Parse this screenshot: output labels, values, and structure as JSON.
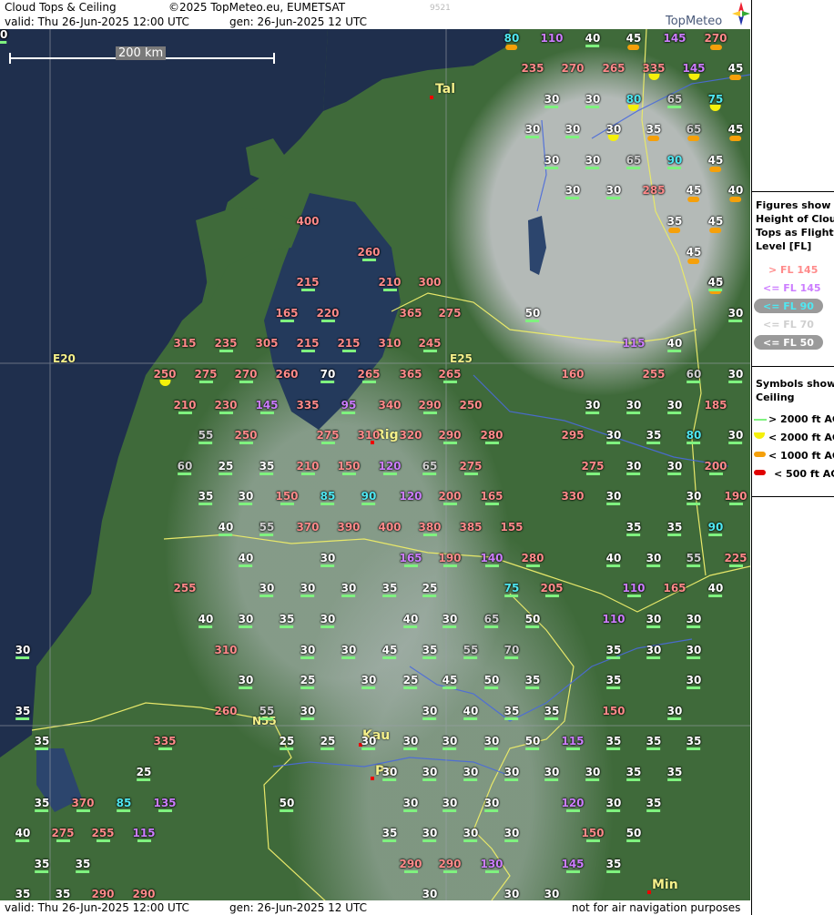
{
  "header": {
    "title": "Cloud Tops & Ceiling",
    "copyright": "©2025 TopMeteo.eu, EUMETSAT",
    "code": "9521",
    "valid": "valid:  Thu  26-Jun-2025  12:00 UTC",
    "gen": "gen: 26-Jun-2025 12 UTC",
    "logo": "TopMeteo"
  },
  "footer": {
    "valid": "valid:  Thu  26-Jun-2025  12:00 UTC",
    "gen": "gen: 26-Jun-2025 12 UTC",
    "disclaimer": "not for air navigation purposes"
  },
  "scale_label": "200 km",
  "grid_labels": [
    "E20",
    "E25",
    "N55"
  ],
  "cities": [
    "Tal",
    "Rig",
    "Kau",
    "Pa",
    "Min"
  ],
  "legend": {
    "fig_heading": [
      "Figures show",
      "Height of Cloud",
      "Tops as Flight",
      "Level  [FL]"
    ],
    "fig_items": [
      "> FL 145",
      "<= FL 145",
      "<= FL 90",
      "<= FL 70",
      "<= FL 50"
    ],
    "sym_heading": [
      "Symbols show",
      "Ceiling"
    ],
    "sym_items": [
      "> 2000 ft AGL",
      "< 2000 ft AGL",
      "< 1000 ft AGL",
      "< 500 ft AGL"
    ],
    "colors": {
      "pink": "#ff8a8a",
      "violet": "#cc7dff",
      "cyan": "#4fe8f2",
      "grey": "#cfcfcf",
      "white": "#ffffff",
      "green": "#7ff27f",
      "yellow": "#f5f00a",
      "orange": "#f5a00a",
      "red": "#e00000"
    }
  },
  "cloud_tops": [
    {
      "v": "80",
      "c": "cyan",
      "s": "o"
    },
    {
      "v": "110",
      "c": "violet",
      "s": ""
    },
    {
      "v": "40",
      "c": "white",
      "s": "g"
    },
    {
      "v": "45",
      "c": "white",
      "s": "o"
    },
    {
      "v": "145",
      "c": "violet",
      "s": ""
    },
    {
      "v": "270",
      "c": "pink",
      "s": "o"
    },
    {
      "v": "235",
      "c": "pink",
      "s": ""
    },
    {
      "v": "270",
      "c": "pink",
      "s": ""
    },
    {
      "v": "265",
      "c": "pink",
      "s": ""
    },
    {
      "v": "335",
      "c": "pink",
      "s": "y"
    },
    {
      "v": "145",
      "c": "violet",
      "s": "y"
    },
    {
      "v": "45",
      "c": "white",
      "s": "o"
    },
    {
      "v": "30",
      "c": "white",
      "s": "g"
    },
    {
      "v": "30",
      "c": "white",
      "s": "g"
    },
    {
      "v": "80",
      "c": "cyan",
      "s": "y"
    },
    {
      "v": "65",
      "c": "grey",
      "s": "g"
    },
    {
      "v": "75",
      "c": "cyan",
      "s": "y"
    },
    {
      "v": "30",
      "c": "white",
      "s": "g"
    },
    {
      "v": "30",
      "c": "white",
      "s": "g"
    },
    {
      "v": "30",
      "c": "white",
      "s": "y"
    },
    {
      "v": "35",
      "c": "white",
      "s": "o"
    },
    {
      "v": "65",
      "c": "grey",
      "s": "o"
    },
    {
      "v": "45",
      "c": "white",
      "s": "o"
    },
    {
      "v": "30",
      "c": "white",
      "s": "g"
    },
    {
      "v": "30",
      "c": "white",
      "s": "g"
    },
    {
      "v": "65",
      "c": "grey",
      "s": "g"
    },
    {
      "v": "90",
      "c": "cyan",
      "s": "g"
    },
    {
      "v": "45",
      "c": "white",
      "s": "o"
    },
    {
      "v": "30",
      "c": "white",
      "s": "g"
    },
    {
      "v": "30",
      "c": "white",
      "s": "g"
    },
    {
      "v": "285",
      "c": "pink",
      "s": ""
    },
    {
      "v": "45",
      "c": "white",
      "s": "o"
    },
    {
      "v": "40",
      "c": "white",
      "s": "o"
    },
    {
      "v": "35",
      "c": "white",
      "s": "o"
    },
    {
      "v": "45",
      "c": "white",
      "s": "o"
    },
    {
      "v": "45",
      "c": "white",
      "s": "o"
    },
    {
      "v": "40",
      "c": "white",
      "s": "o"
    },
    {
      "v": "45",
      "c": "white",
      "s": "g"
    },
    {
      "v": "400",
      "c": "pink",
      "s": ""
    },
    {
      "v": "260",
      "c": "pink",
      "s": "g"
    },
    {
      "v": "215",
      "c": "pink",
      "s": "g"
    },
    {
      "v": "210",
      "c": "pink",
      "s": "g"
    },
    {
      "v": "300",
      "c": "pink",
      "s": ""
    },
    {
      "v": "165",
      "c": "pink",
      "s": "g"
    },
    {
      "v": "220",
      "c": "pink",
      "s": "g"
    },
    {
      "v": "365",
      "c": "pink",
      "s": ""
    },
    {
      "v": "275",
      "c": "pink",
      "s": ""
    },
    {
      "v": "50",
      "c": "white",
      "s": "g"
    },
    {
      "v": "30",
      "c": "white",
      "s": "g"
    },
    {
      "v": "315",
      "c": "pink",
      "s": ""
    },
    {
      "v": "235",
      "c": "pink",
      "s": "g"
    },
    {
      "v": "305",
      "c": "pink",
      "s": ""
    },
    {
      "v": "215",
      "c": "pink",
      "s": "g"
    },
    {
      "v": "215",
      "c": "pink",
      "s": "g"
    },
    {
      "v": "310",
      "c": "pink",
      "s": ""
    },
    {
      "v": "245",
      "c": "pink",
      "s": "g"
    },
    {
      "v": "115",
      "c": "violet",
      "s": ""
    },
    {
      "v": "40",
      "c": "white",
      "s": "g"
    },
    {
      "v": "250",
      "c": "pink",
      "s": "y"
    },
    {
      "v": "275",
      "c": "pink",
      "s": "g"
    },
    {
      "v": "270",
      "c": "pink",
      "s": "g"
    },
    {
      "v": "260",
      "c": "pink",
      "s": ""
    },
    {
      "v": "70",
      "c": "white",
      "s": "g"
    },
    {
      "v": "265",
      "c": "pink",
      "s": "g"
    },
    {
      "v": "365",
      "c": "pink",
      "s": ""
    },
    {
      "v": "265",
      "c": "pink",
      "s": "g"
    },
    {
      "v": "160",
      "c": "pink",
      "s": ""
    },
    {
      "v": "255",
      "c": "pink",
      "s": ""
    },
    {
      "v": "60",
      "c": "grey",
      "s": "g"
    },
    {
      "v": "30",
      "c": "white",
      "s": "g"
    },
    {
      "v": "210",
      "c": "pink",
      "s": "g"
    },
    {
      "v": "230",
      "c": "pink",
      "s": "g"
    },
    {
      "v": "145",
      "c": "violet",
      "s": "g"
    },
    {
      "v": "335",
      "c": "pink",
      "s": ""
    },
    {
      "v": "95",
      "c": "violet",
      "s": "g"
    },
    {
      "v": "340",
      "c": "pink",
      "s": ""
    },
    {
      "v": "290",
      "c": "pink",
      "s": "g"
    },
    {
      "v": "250",
      "c": "pink",
      "s": ""
    },
    {
      "v": "30",
      "c": "white",
      "s": "g"
    },
    {
      "v": "30",
      "c": "white",
      "s": "g"
    },
    {
      "v": "30",
      "c": "white",
      "s": "g"
    },
    {
      "v": "185",
      "c": "pink",
      "s": ""
    },
    {
      "v": "55",
      "c": "grey",
      "s": "g"
    },
    {
      "v": "250",
      "c": "pink",
      "s": "g"
    },
    {
      "v": "275",
      "c": "pink",
      "s": "g"
    },
    {
      "v": "310",
      "c": "pink",
      "s": ""
    },
    {
      "v": "320",
      "c": "pink",
      "s": ""
    },
    {
      "v": "290",
      "c": "pink",
      "s": "g"
    },
    {
      "v": "280",
      "c": "pink",
      "s": "g"
    },
    {
      "v": "295",
      "c": "pink",
      "s": ""
    },
    {
      "v": "30",
      "c": "white",
      "s": "g"
    },
    {
      "v": "35",
      "c": "white",
      "s": "g"
    },
    {
      "v": "80",
      "c": "cyan",
      "s": "g"
    },
    {
      "v": "30",
      "c": "white",
      "s": "g"
    },
    {
      "v": "60",
      "c": "grey",
      "s": "g"
    },
    {
      "v": "25",
      "c": "white",
      "s": "g"
    },
    {
      "v": "35",
      "c": "white",
      "s": "g"
    },
    {
      "v": "210",
      "c": "pink",
      "s": "g"
    },
    {
      "v": "150",
      "c": "pink",
      "s": "g"
    },
    {
      "v": "120",
      "c": "violet",
      "s": "g"
    },
    {
      "v": "65",
      "c": "grey",
      "s": "g"
    },
    {
      "v": "275",
      "c": "pink",
      "s": "g"
    },
    {
      "v": "275",
      "c": "pink",
      "s": "g"
    },
    {
      "v": "30",
      "c": "white",
      "s": "g"
    },
    {
      "v": "30",
      "c": "white",
      "s": "g"
    },
    {
      "v": "200",
      "c": "pink",
      "s": "g"
    },
    {
      "v": "35",
      "c": "white",
      "s": "g"
    },
    {
      "v": "30",
      "c": "white",
      "s": "g"
    },
    {
      "v": "150",
      "c": "pink",
      "s": "g"
    },
    {
      "v": "85",
      "c": "cyan",
      "s": "g"
    },
    {
      "v": "90",
      "c": "cyan",
      "s": "g"
    },
    {
      "v": "120",
      "c": "violet",
      "s": ""
    },
    {
      "v": "200",
      "c": "pink",
      "s": "g"
    },
    {
      "v": "165",
      "c": "pink",
      "s": "g"
    },
    {
      "v": "330",
      "c": "pink",
      "s": ""
    },
    {
      "v": "30",
      "c": "white",
      "s": "g"
    },
    {
      "v": "30",
      "c": "white",
      "s": "g"
    },
    {
      "v": "190",
      "c": "pink",
      "s": "g"
    },
    {
      "v": "40",
      "c": "white",
      "s": "g"
    },
    {
      "v": "55",
      "c": "grey",
      "s": "g"
    },
    {
      "v": "370",
      "c": "pink",
      "s": ""
    },
    {
      "v": "390",
      "c": "pink",
      "s": ""
    },
    {
      "v": "400",
      "c": "pink",
      "s": ""
    },
    {
      "v": "380",
      "c": "pink",
      "s": "g"
    },
    {
      "v": "385",
      "c": "pink",
      "s": ""
    },
    {
      "v": "155",
      "c": "pink",
      "s": ""
    },
    {
      "v": "35",
      "c": "white",
      "s": "g"
    },
    {
      "v": "35",
      "c": "white",
      "s": "g"
    },
    {
      "v": "90",
      "c": "cyan",
      "s": "g"
    },
    {
      "v": "40",
      "c": "white",
      "s": "g"
    },
    {
      "v": "30",
      "c": "white",
      "s": "g"
    },
    {
      "v": "165",
      "c": "violet",
      "s": "g"
    },
    {
      "v": "190",
      "c": "pink",
      "s": "g"
    },
    {
      "v": "140",
      "c": "violet",
      "s": "g"
    },
    {
      "v": "280",
      "c": "pink",
      "s": "g"
    },
    {
      "v": "40",
      "c": "white",
      "s": "g"
    },
    {
      "v": "30",
      "c": "white",
      "s": "g"
    },
    {
      "v": "55",
      "c": "grey",
      "s": "g"
    },
    {
      "v": "225",
      "c": "pink",
      "s": "g"
    },
    {
      "v": "255",
      "c": "pink",
      "s": ""
    },
    {
      "v": "30",
      "c": "white",
      "s": "g"
    },
    {
      "v": "30",
      "c": "white",
      "s": "g"
    },
    {
      "v": "30",
      "c": "white",
      "s": "g"
    },
    {
      "v": "35",
      "c": "white",
      "s": "g"
    },
    {
      "v": "25",
      "c": "white",
      "s": "g"
    },
    {
      "v": "75",
      "c": "cyan",
      "s": "g"
    },
    {
      "v": "205",
      "c": "pink",
      "s": "g"
    },
    {
      "v": "110",
      "c": "violet",
      "s": "g"
    },
    {
      "v": "165",
      "c": "pink",
      "s": ""
    },
    {
      "v": "40",
      "c": "white",
      "s": "g"
    },
    {
      "v": "40",
      "c": "white",
      "s": "g"
    },
    {
      "v": "30",
      "c": "white",
      "s": "g"
    },
    {
      "v": "35",
      "c": "white",
      "s": "g"
    },
    {
      "v": "30",
      "c": "white",
      "s": "g"
    },
    {
      "v": "40",
      "c": "white",
      "s": "g"
    },
    {
      "v": "30",
      "c": "white",
      "s": "g"
    },
    {
      "v": "65",
      "c": "grey",
      "s": "g"
    },
    {
      "v": "50",
      "c": "white",
      "s": "g"
    },
    {
      "v": "110",
      "c": "violet",
      "s": ""
    },
    {
      "v": "30",
      "c": "white",
      "s": "g"
    },
    {
      "v": "30",
      "c": "white",
      "s": "g"
    },
    {
      "v": "30",
      "c": "white",
      "s": "g"
    },
    {
      "v": "310",
      "c": "pink",
      "s": ""
    },
    {
      "v": "30",
      "c": "white",
      "s": "g"
    },
    {
      "v": "30",
      "c": "white",
      "s": "g"
    },
    {
      "v": "45",
      "c": "white",
      "s": "g"
    },
    {
      "v": "35",
      "c": "white",
      "s": "g"
    },
    {
      "v": "55",
      "c": "grey",
      "s": "g"
    },
    {
      "v": "70",
      "c": "grey",
      "s": "g"
    },
    {
      "v": "35",
      "c": "white",
      "s": "g"
    },
    {
      "v": "30",
      "c": "white",
      "s": "g"
    },
    {
      "v": "30",
      "c": "white",
      "s": "g"
    },
    {
      "v": "30",
      "c": "white",
      "s": "g"
    },
    {
      "v": "25",
      "c": "white",
      "s": "g"
    },
    {
      "v": "30",
      "c": "white",
      "s": "g"
    },
    {
      "v": "25",
      "c": "white",
      "s": "g"
    },
    {
      "v": "45",
      "c": "white",
      "s": "g"
    },
    {
      "v": "50",
      "c": "white",
      "s": "g"
    },
    {
      "v": "35",
      "c": "white",
      "s": "g"
    },
    {
      "v": "35",
      "c": "white",
      "s": "g"
    },
    {
      "v": "30",
      "c": "white",
      "s": "g"
    },
    {
      "v": "35",
      "c": "white",
      "s": "g"
    },
    {
      "v": "260",
      "c": "pink",
      "s": ""
    },
    {
      "v": "55",
      "c": "grey",
      "s": "g"
    },
    {
      "v": "30",
      "c": "white",
      "s": "g"
    },
    {
      "v": "30",
      "c": "white",
      "s": "g"
    },
    {
      "v": "40",
      "c": "white",
      "s": "g"
    },
    {
      "v": "35",
      "c": "white",
      "s": "g"
    },
    {
      "v": "35",
      "c": "white",
      "s": "g"
    },
    {
      "v": "150",
      "c": "pink",
      "s": ""
    },
    {
      "v": "30",
      "c": "white",
      "s": "g"
    },
    {
      "v": "35",
      "c": "white",
      "s": "g"
    },
    {
      "v": "335",
      "c": "pink",
      "s": "g"
    },
    {
      "v": "25",
      "c": "white",
      "s": "g"
    },
    {
      "v": "25",
      "c": "white",
      "s": "g"
    },
    {
      "v": "30",
      "c": "white",
      "s": "g"
    },
    {
      "v": "30",
      "c": "white",
      "s": "g"
    },
    {
      "v": "30",
      "c": "white",
      "s": "g"
    },
    {
      "v": "30",
      "c": "white",
      "s": "g"
    },
    {
      "v": "50",
      "c": "white",
      "s": "g"
    },
    {
      "v": "115",
      "c": "violet",
      "s": "g"
    },
    {
      "v": "35",
      "c": "white",
      "s": "g"
    },
    {
      "v": "35",
      "c": "white",
      "s": "g"
    },
    {
      "v": "35",
      "c": "white",
      "s": "g"
    },
    {
      "v": "25",
      "c": "white",
      "s": "g"
    },
    {
      "v": "30",
      "c": "white",
      "s": "g"
    },
    {
      "v": "30",
      "c": "white",
      "s": "g"
    },
    {
      "v": "30",
      "c": "white",
      "s": "g"
    },
    {
      "v": "30",
      "c": "white",
      "s": "g"
    },
    {
      "v": "30",
      "c": "white",
      "s": "g"
    },
    {
      "v": "30",
      "c": "white",
      "s": "g"
    },
    {
      "v": "35",
      "c": "white",
      "s": "g"
    },
    {
      "v": "35",
      "c": "white",
      "s": "g"
    },
    {
      "v": "35",
      "c": "white",
      "s": "g"
    },
    {
      "v": "370",
      "c": "pink",
      "s": "g"
    },
    {
      "v": "85",
      "c": "cyan",
      "s": "g"
    },
    {
      "v": "135",
      "c": "violet",
      "s": "g"
    },
    {
      "v": "50",
      "c": "white",
      "s": "g"
    },
    {
      "v": "30",
      "c": "white",
      "s": "g"
    },
    {
      "v": "30",
      "c": "white",
      "s": "g"
    },
    {
      "v": "30",
      "c": "white",
      "s": "g"
    },
    {
      "v": "120",
      "c": "violet",
      "s": "g"
    },
    {
      "v": "30",
      "c": "white",
      "s": "g"
    },
    {
      "v": "35",
      "c": "white",
      "s": "g"
    },
    {
      "v": "40",
      "c": "white",
      "s": "g"
    },
    {
      "v": "275",
      "c": "pink",
      "s": "g"
    },
    {
      "v": "255",
      "c": "pink",
      "s": "g"
    },
    {
      "v": "115",
      "c": "violet",
      "s": "g"
    },
    {
      "v": "35",
      "c": "white",
      "s": "g"
    },
    {
      "v": "30",
      "c": "white",
      "s": "g"
    },
    {
      "v": "30",
      "c": "white",
      "s": "g"
    },
    {
      "v": "30",
      "c": "white",
      "s": "g"
    },
    {
      "v": "150",
      "c": "pink",
      "s": "g"
    },
    {
      "v": "50",
      "c": "white",
      "s": "g"
    },
    {
      "v": "35",
      "c": "white",
      "s": "g"
    },
    {
      "v": "35",
      "c": "white",
      "s": "g"
    },
    {
      "v": "290",
      "c": "pink",
      "s": "g"
    },
    {
      "v": "290",
      "c": "pink",
      "s": "g"
    },
    {
      "v": "130",
      "c": "violet",
      "s": "g"
    },
    {
      "v": "145",
      "c": "violet",
      "s": "g"
    },
    {
      "v": "35",
      "c": "white",
      "s": "g"
    },
    {
      "v": "35",
      "c": "white",
      "s": "g"
    },
    {
      "v": "35",
      "c": "white",
      "s": "g"
    },
    {
      "v": "290",
      "c": "pink",
      "s": "g"
    },
    {
      "v": "290",
      "c": "pink",
      "s": "g"
    },
    {
      "v": "30",
      "c": "white",
      "s": "g"
    },
    {
      "v": "30",
      "c": "white",
      "s": "g"
    },
    {
      "v": "30",
      "c": "white",
      "s": "g"
    },
    {
      "v": "30",
      "c": "white",
      "s": "g"
    },
    {
      "v": "30",
      "c": "white",
      "s": "g"
    }
  ]
}
